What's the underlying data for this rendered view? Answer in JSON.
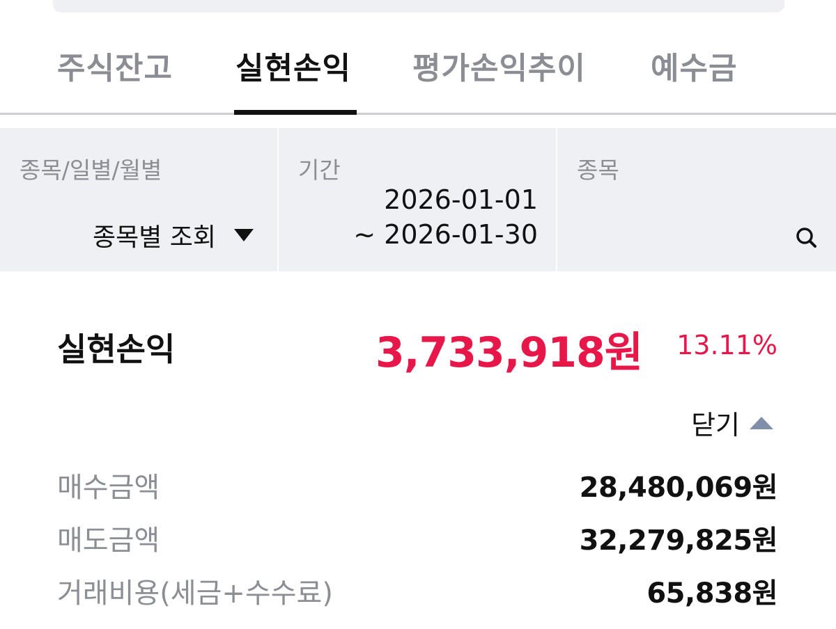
{
  "tabs": [
    {
      "label": "주식잔고",
      "active": false
    },
    {
      "label": "실현손익",
      "active": true
    },
    {
      "label": "평가손익추이",
      "active": false
    },
    {
      "label": "예수금",
      "active": false
    }
  ],
  "filters": {
    "view_type": {
      "label": "종목/일별/월별",
      "value": "종목별 조회",
      "icon": "triangle-down-icon"
    },
    "period": {
      "label": "기간",
      "start": "2026-01-01",
      "end": "~ 2026-01-30"
    },
    "stock": {
      "label": "종목",
      "icon": "search-icon"
    }
  },
  "summary": {
    "label": "실현손익",
    "amount": "3,733,918원",
    "rate": "13.11%",
    "accent_color": "#e8174a"
  },
  "toggle": {
    "label": "닫기",
    "icon": "triangle-up-icon"
  },
  "details": [
    {
      "label": "매수금액",
      "value": "28,480,069원"
    },
    {
      "label": "매도금액",
      "value": "32,279,825원"
    },
    {
      "label": "거래비용(세금+수수료)",
      "value": "65,838원"
    }
  ]
}
